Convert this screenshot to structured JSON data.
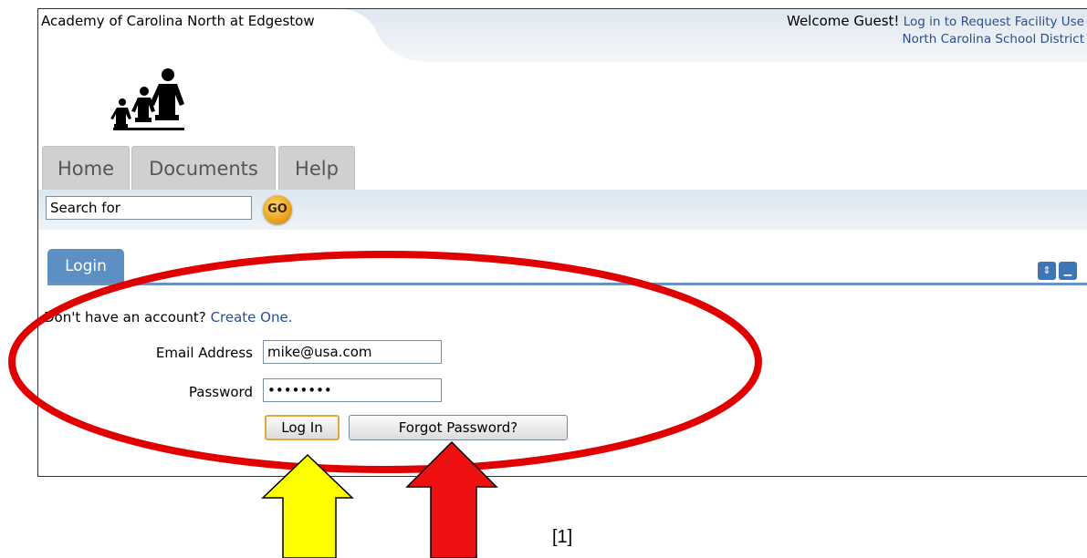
{
  "header": {
    "school_name": "Academy of Carolina North at Edgestow",
    "welcome_text": "Welcome Guest!",
    "login_link": "Log in to Request Facility Use",
    "district_link": "North Carolina School District"
  },
  "nav": {
    "tabs": [
      {
        "label": "Home"
      },
      {
        "label": "Documents"
      },
      {
        "label": "Help"
      }
    ]
  },
  "search": {
    "value": "Search for",
    "go_label": "GO"
  },
  "login_panel": {
    "tab_label": "Login",
    "no_account_text": "Don't have an account?",
    "create_link": "Create One.",
    "email_label": "Email Address",
    "email_value": "mike@usa.com",
    "password_label": "Password",
    "password_value": "password",
    "login_button": "Log In",
    "forgot_button": "Forgot Password?"
  },
  "annotations": {
    "caption": "[1]",
    "oval_color": "#e00000",
    "yellow_arrow_color": "#ffff00",
    "red_arrow_color": "#ee1111"
  }
}
